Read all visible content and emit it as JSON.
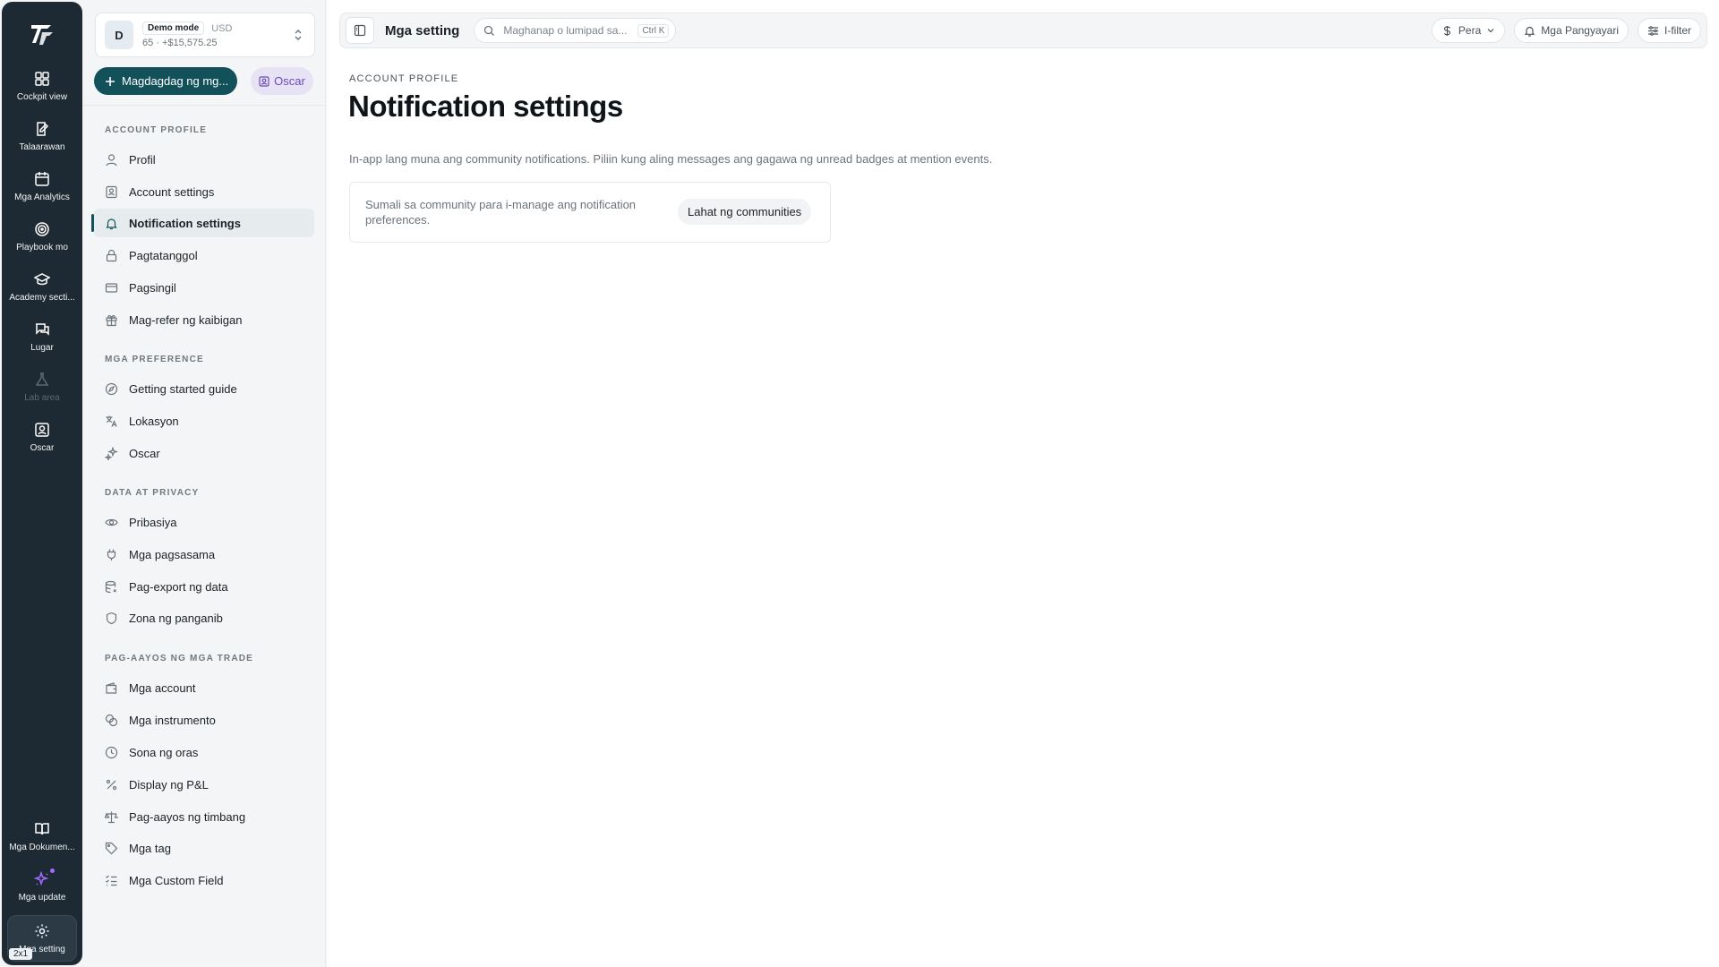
{
  "rail": {
    "items": [
      {
        "label": "Cockpit view",
        "icon": "dashboard-icon"
      },
      {
        "label": "Talaarawan",
        "icon": "journal-icon"
      },
      {
        "label": "Mga Analytics",
        "icon": "calendar-icon"
      },
      {
        "label": "Playbook mo",
        "icon": "target-icon"
      },
      {
        "label": "Academy secti...",
        "icon": "graduation-cap-icon"
      },
      {
        "label": "Lugar",
        "icon": "chat-icon"
      },
      {
        "label": "Lab area",
        "icon": "flask-icon"
      },
      {
        "label": "Oscar",
        "icon": "oscar-icon"
      }
    ],
    "bottom": [
      {
        "label": "Mga Dokumen...",
        "icon": "book-icon"
      },
      {
        "label": "Mga update",
        "icon": "sparkle-icon"
      },
      {
        "label": "Mga setting",
        "icon": "gear-icon"
      }
    ],
    "zoom_badge": "2x1"
  },
  "account": {
    "avatar": "D",
    "mode": "Demo mode",
    "currency": "USD",
    "balance": "65 · +$15,575.25"
  },
  "actions": {
    "add_label": "Magdagdag ng mg...",
    "oscar_label": "Oscar"
  },
  "sidebar": {
    "sections": [
      {
        "title": "ACCOUNT PROFILE",
        "items": [
          {
            "label": "Profil",
            "icon": "user-icon"
          },
          {
            "label": "Account settings",
            "icon": "contact-card-icon"
          },
          {
            "label": "Notification settings",
            "icon": "bell-icon",
            "active": true
          },
          {
            "label": "Pagtatanggol",
            "icon": "lock-icon"
          },
          {
            "label": "Pagsingil",
            "icon": "credit-card-icon"
          },
          {
            "label": "Mag-refer ng kaibigan",
            "icon": "gift-icon"
          }
        ]
      },
      {
        "title": "MGA PREFERENCE",
        "items": [
          {
            "label": "Getting started guide",
            "icon": "compass-icon"
          },
          {
            "label": "Lokasyon",
            "icon": "translate-icon"
          },
          {
            "label": "Oscar",
            "icon": "sparkles-icon"
          }
        ]
      },
      {
        "title": "DATA AT PRIVACY",
        "items": [
          {
            "label": "Pribasiya",
            "icon": "eye-icon"
          },
          {
            "label": "Mga pagsasama",
            "icon": "plug-icon"
          },
          {
            "label": "Pag-export ng data",
            "icon": "database-export-icon"
          },
          {
            "label": "Zona ng panganib",
            "icon": "shield-icon"
          }
        ]
      },
      {
        "title": "PAG-AAYOS NG MGA TRADE",
        "items": [
          {
            "label": "Mga account",
            "icon": "wallet-icon"
          },
          {
            "label": "Mga instrumento",
            "icon": "coins-icon"
          },
          {
            "label": "Sona ng oras",
            "icon": "clock-icon"
          },
          {
            "label": "Display ng P&L",
            "icon": "percent-icon"
          },
          {
            "label": "Pag-aayos ng timbang",
            "icon": "scale-icon"
          },
          {
            "label": "Mga tag",
            "icon": "tag-icon"
          },
          {
            "label": "Mga Custom Field",
            "icon": "list-checks-icon"
          }
        ]
      }
    ]
  },
  "topbar": {
    "title": "Mga setting",
    "search_placeholder": "Maghanap o lumipad sa...",
    "search_shortcut": "Ctrl K",
    "currency_label": "Pera",
    "events_label": "Mga Pangyayari",
    "filter_label": "I-filter"
  },
  "content": {
    "breadcrumb": "ACCOUNT PROFILE",
    "title": "Notification settings",
    "description": "In-app lang muna ang community notifications. Piliin kung aling messages ang gagawa ng unread badges at mention events.",
    "card_text": "Sumali sa community para i-manage ang notification preferences.",
    "card_button": "Lahat ng communities"
  },
  "colors": {
    "rail_bg": "#1d2a33",
    "accent": "#12505a",
    "oscar_accent": "#6b4bb8"
  }
}
